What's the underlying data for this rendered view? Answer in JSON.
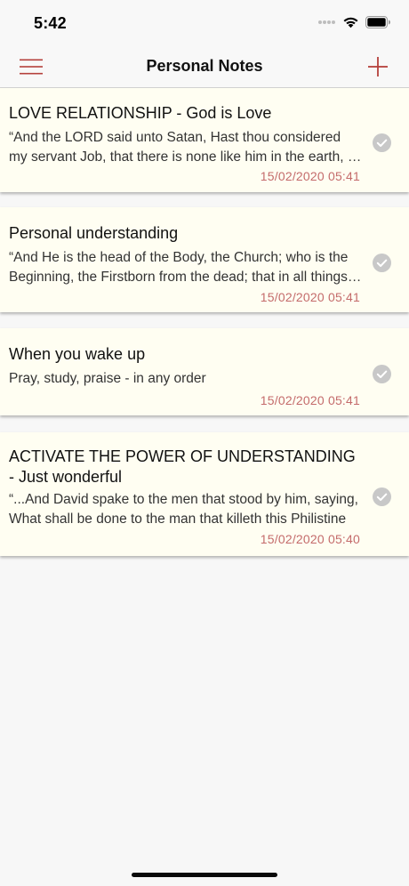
{
  "status": {
    "time": "5:42"
  },
  "nav": {
    "title": "Personal Notes",
    "menu_icon": "hamburger-menu-icon",
    "add_icon": "plus-icon"
  },
  "colors": {
    "accent": "#b5413c",
    "card_bg": "#fffef2",
    "date": "#c46b6b",
    "check": "#c8c8c8"
  },
  "notes": [
    {
      "title": "LOVE RELATIONSHIP - God is Love",
      "preview": "“And the LORD said unto Satan, Hast thou considered my servant Job, that there is none like him in the earth, a perfect and an upright man",
      "date": "15/02/2020 05:41",
      "icon": "checkmark-circle-icon"
    },
    {
      "title": "Personal understanding",
      "preview": "“And He is the head of the Body, the Church; who is the Beginning, the Firstborn from the dead; that in all things He might have the preeminence",
      "date": "15/02/2020 05:41",
      "icon": "checkmark-circle-icon"
    },
    {
      "title": "When you wake up",
      "preview": "Pray, study, praise - in any order",
      "date": "15/02/2020 05:41",
      "icon": "checkmark-circle-icon"
    },
    {
      "title": "ACTIVATE THE POWER OF UNDERSTANDING - Just wonderful",
      "preview": "“...And David spake to the men that stood by him, saying, What shall be done to the man that killeth this Philistine",
      "date": "15/02/2020 05:40",
      "icon": "checkmark-circle-icon"
    }
  ]
}
